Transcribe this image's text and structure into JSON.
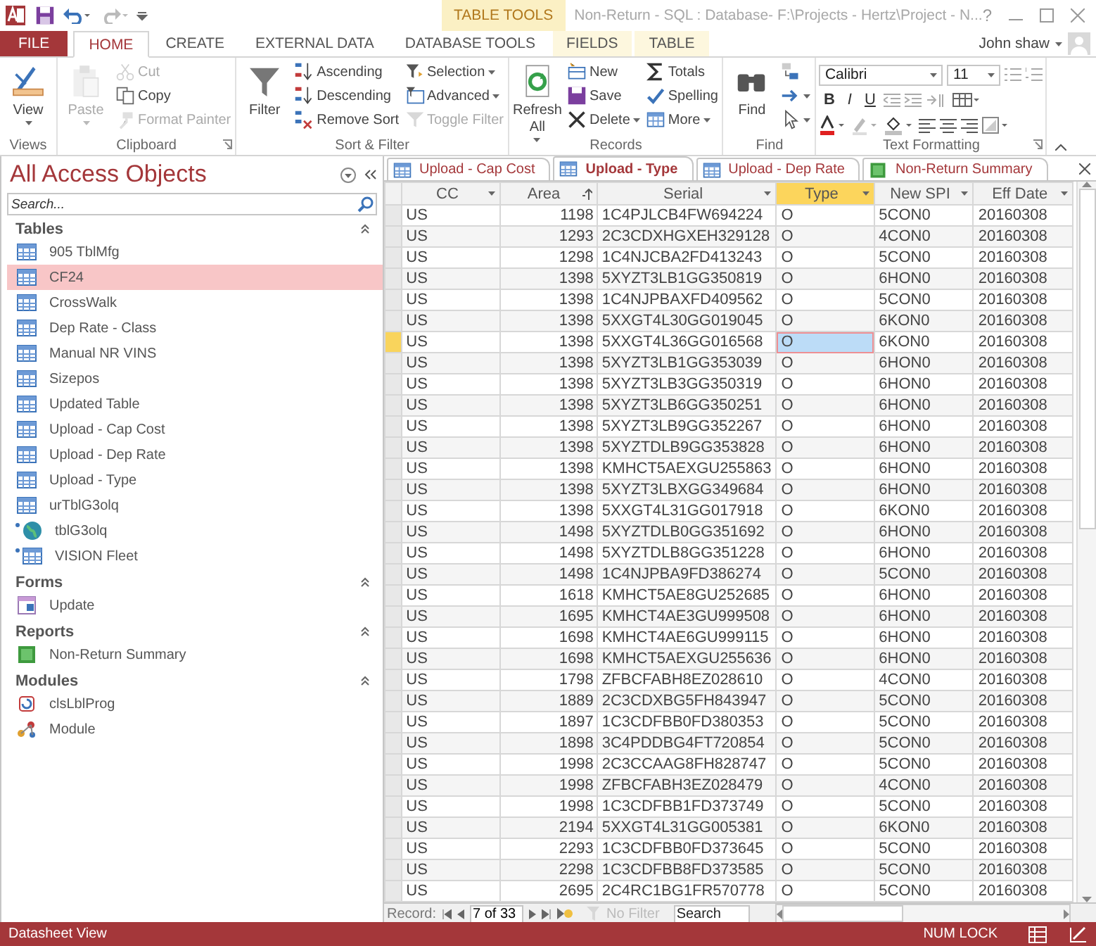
{
  "window": {
    "title": "Non-Return - SQL : Database- F:\\Projects - Hertz\\Project - N...",
    "context_group": "TABLE TOOLS",
    "help": "?",
    "user": "John shaw"
  },
  "ribbon_tabs": [
    {
      "label": "FILE",
      "kind": "file",
      "selected": false
    },
    {
      "label": "HOME",
      "kind": "main",
      "selected": true
    },
    {
      "label": "CREATE",
      "kind": "main",
      "selected": false
    },
    {
      "label": "EXTERNAL DATA",
      "kind": "main",
      "selected": false
    },
    {
      "label": "DATABASE TOOLS",
      "kind": "main",
      "selected": false
    },
    {
      "label": "FIELDS",
      "kind": "context",
      "selected": false
    },
    {
      "label": "TABLE",
      "kind": "context",
      "selected": false
    }
  ],
  "ribbon_groups": [
    {
      "label": "Views",
      "launcher": false,
      "commands": [
        {
          "label": "View",
          "kind": "large",
          "dropdown": true,
          "disabled": false
        }
      ]
    },
    {
      "label": "Clipboard",
      "launcher": true,
      "commands": [
        {
          "label": "Paste",
          "kind": "large",
          "dropdown": true,
          "disabled": true
        },
        {
          "label": "Cut",
          "kind": "small",
          "dropdown": false,
          "disabled": true
        },
        {
          "label": "Copy",
          "kind": "small",
          "dropdown": false,
          "disabled": false
        },
        {
          "label": "Format Painter",
          "kind": "small",
          "dropdown": false,
          "disabled": true
        }
      ]
    },
    {
      "label": "Sort & Filter",
      "launcher": false,
      "commands": [
        {
          "label": "Filter",
          "kind": "large",
          "dropdown": false,
          "disabled": false
        },
        {
          "label": "Ascending",
          "kind": "small",
          "dropdown": false,
          "disabled": false
        },
        {
          "label": "Descending",
          "kind": "small",
          "dropdown": false,
          "disabled": false
        },
        {
          "label": "Remove Sort",
          "kind": "small",
          "dropdown": false,
          "disabled": false
        },
        {
          "label": "Selection",
          "kind": "small",
          "dropdown": true,
          "disabled": false
        },
        {
          "label": "Advanced",
          "kind": "small",
          "dropdown": true,
          "disabled": false
        },
        {
          "label": "Toggle Filter",
          "kind": "small",
          "dropdown": false,
          "disabled": true
        }
      ]
    },
    {
      "label": "Records",
      "launcher": false,
      "commands": [
        {
          "label": "Refresh All",
          "kind": "large",
          "dropdown": true,
          "disabled": false
        },
        {
          "label": "New",
          "kind": "small",
          "dropdown": false,
          "disabled": false
        },
        {
          "label": "Save",
          "kind": "small",
          "dropdown": false,
          "disabled": false
        },
        {
          "label": "Delete",
          "kind": "small",
          "dropdown": true,
          "disabled": false
        },
        {
          "label": "Totals",
          "kind": "small",
          "dropdown": false,
          "disabled": false
        },
        {
          "label": "Spelling",
          "kind": "small",
          "dropdown": false,
          "disabled": false
        },
        {
          "label": "More",
          "kind": "small",
          "dropdown": true,
          "disabled": false
        }
      ]
    },
    {
      "label": "Find",
      "launcher": false,
      "commands": [
        {
          "label": "Find",
          "kind": "large",
          "dropdown": false,
          "disabled": false
        },
        {
          "kind": "icon",
          "dropdown": false,
          "disabled": false
        },
        {
          "kind": "icon",
          "dropdown": true,
          "disabled": false
        },
        {
          "kind": "icon",
          "dropdown": true,
          "disabled": false
        }
      ]
    },
    {
      "label": "Text Formatting",
      "launcher": true,
      "font": "Calibri",
      "size": "11",
      "format_buttons": [
        "B",
        "I",
        "U"
      ]
    }
  ],
  "navigation": {
    "title": "All Access Objects",
    "search_placeholder": "Search...",
    "groups": [
      {
        "label": "Tables",
        "expanded": true,
        "items": [
          {
            "label": "905 TblMfg",
            "kind": "table",
            "selected": false
          },
          {
            "label": "CF24",
            "kind": "table",
            "selected": true
          },
          {
            "label": "CrossWalk",
            "kind": "table",
            "selected": false
          },
          {
            "label": "Dep Rate - Class",
            "kind": "table",
            "selected": false
          },
          {
            "label": "Manual NR VINS",
            "kind": "table",
            "selected": false
          },
          {
            "label": "Sizepos",
            "kind": "table",
            "selected": false
          },
          {
            "label": "Updated Table",
            "kind": "table",
            "selected": false
          },
          {
            "label": "Upload - Cap Cost",
            "kind": "table",
            "selected": false
          },
          {
            "label": "Upload - Dep Rate",
            "kind": "table",
            "selected": false
          },
          {
            "label": "Upload - Type",
            "kind": "table",
            "selected": false
          },
          {
            "label": "urTblG3olq",
            "kind": "table",
            "selected": false
          },
          {
            "label": "tblG3olq",
            "kind": "linked_web",
            "selected": false
          },
          {
            "label": "VISION Fleet",
            "kind": "linked_table",
            "selected": false
          }
        ]
      },
      {
        "label": "Forms",
        "expanded": true,
        "items": [
          {
            "label": "Update",
            "kind": "form",
            "selected": false
          }
        ]
      },
      {
        "label": "Reports",
        "expanded": true,
        "items": [
          {
            "label": "Non-Return Summary",
            "kind": "report",
            "selected": false
          }
        ]
      },
      {
        "label": "Modules",
        "expanded": true,
        "items": [
          {
            "label": "clsLblProg",
            "kind": "class_module",
            "selected": false
          },
          {
            "label": "Module",
            "kind": "module",
            "selected": false
          }
        ]
      }
    ]
  },
  "document_tabs": [
    {
      "label": "Upload - Cap Cost",
      "kind": "table",
      "selected": false
    },
    {
      "label": "Upload - Type",
      "kind": "table",
      "selected": true
    },
    {
      "label": "Upload - Dep Rate",
      "kind": "table",
      "selected": false
    },
    {
      "label": "Non-Return Summary",
      "kind": "report",
      "selected": false
    }
  ],
  "datasheet": {
    "columns": [
      {
        "label": "CC",
        "kind": "text",
        "sorted": false,
        "selected": false
      },
      {
        "label": "Area",
        "kind": "number",
        "sorted": true,
        "selected": false
      },
      {
        "label": "Serial",
        "kind": "text",
        "sorted": false,
        "selected": false
      },
      {
        "label": "Type",
        "kind": "text",
        "sorted": false,
        "selected": true
      },
      {
        "label": "New SPI",
        "kind": "text",
        "sorted": false,
        "selected": false
      },
      {
        "label": "Eff Date",
        "kind": "text",
        "sorted": false,
        "selected": false
      }
    ],
    "rows": [
      {
        "selected": false,
        "cells": [
          "US",
          "1198",
          "1C4PJLCB4FW694224",
          "O",
          "5CON0",
          "20160308"
        ]
      },
      {
        "selected": false,
        "cells": [
          "US",
          "1293",
          "2C3CDXHGXEH329128",
          "O",
          "4CON0",
          "20160308"
        ]
      },
      {
        "selected": false,
        "cells": [
          "US",
          "1298",
          "1C4NJCBA2FD413243",
          "O",
          "5CON0",
          "20160308"
        ]
      },
      {
        "selected": false,
        "cells": [
          "US",
          "1398",
          "5XYZT3LB1GG350819",
          "O",
          "6HON0",
          "20160308"
        ]
      },
      {
        "selected": false,
        "cells": [
          "US",
          "1398",
          "1C4NJPBAXFD409562",
          "O",
          "5CON0",
          "20160308"
        ]
      },
      {
        "selected": false,
        "cells": [
          "US",
          "1398",
          "5XXGT4L30GG019045",
          "O",
          "6KON0",
          "20160308"
        ]
      },
      {
        "selected": true,
        "cells": [
          "US",
          "1398",
          "5XXGT4L36GG016568",
          "O",
          "6KON0",
          "20160308"
        ]
      },
      {
        "selected": false,
        "cells": [
          "US",
          "1398",
          "5XYZT3LB1GG353039",
          "O",
          "6HON0",
          "20160308"
        ]
      },
      {
        "selected": false,
        "cells": [
          "US",
          "1398",
          "5XYZT3LB3GG350319",
          "O",
          "6HON0",
          "20160308"
        ]
      },
      {
        "selected": false,
        "cells": [
          "US",
          "1398",
          "5XYZT3LB6GG350251",
          "O",
          "6HON0",
          "20160308"
        ]
      },
      {
        "selected": false,
        "cells": [
          "US",
          "1398",
          "5XYZT3LB9GG352267",
          "O",
          "6HON0",
          "20160308"
        ]
      },
      {
        "selected": false,
        "cells": [
          "US",
          "1398",
          "5XYZTDLB9GG353828",
          "O",
          "6HON0",
          "20160308"
        ]
      },
      {
        "selected": false,
        "cells": [
          "US",
          "1398",
          "KMHCT5AEXGU255863",
          "O",
          "6HON0",
          "20160308"
        ]
      },
      {
        "selected": false,
        "cells": [
          "US",
          "1398",
          "5XYZT3LBXGG349684",
          "O",
          "6HON0",
          "20160308"
        ]
      },
      {
        "selected": false,
        "cells": [
          "US",
          "1398",
          "5XXGT4L31GG017918",
          "O",
          "6KON0",
          "20160308"
        ]
      },
      {
        "selected": false,
        "cells": [
          "US",
          "1498",
          "5XYZTDLB0GG351692",
          "O",
          "6HON0",
          "20160308"
        ]
      },
      {
        "selected": false,
        "cells": [
          "US",
          "1498",
          "5XYZTDLB8GG351228",
          "O",
          "6HON0",
          "20160308"
        ]
      },
      {
        "selected": false,
        "cells": [
          "US",
          "1498",
          "1C4NJPBA9FD386274",
          "O",
          "5CON0",
          "20160308"
        ]
      },
      {
        "selected": false,
        "cells": [
          "US",
          "1618",
          "KMHCT5AE8GU252685",
          "O",
          "6HON0",
          "20160308"
        ]
      },
      {
        "selected": false,
        "cells": [
          "US",
          "1695",
          "KMHCT4AE3GU999508",
          "O",
          "6HON0",
          "20160308"
        ]
      },
      {
        "selected": false,
        "cells": [
          "US",
          "1698",
          "KMHCT4AE6GU999115",
          "O",
          "6HON0",
          "20160308"
        ]
      },
      {
        "selected": false,
        "cells": [
          "US",
          "1698",
          "KMHCT5AEXGU255636",
          "O",
          "6HON0",
          "20160308"
        ]
      },
      {
        "selected": false,
        "cells": [
          "US",
          "1798",
          "ZFBCFABH8EZ028610",
          "O",
          "4CON0",
          "20160308"
        ]
      },
      {
        "selected": false,
        "cells": [
          "US",
          "1889",
          "2C3CDXBG5FH843947",
          "O",
          "5CON0",
          "20160308"
        ]
      },
      {
        "selected": false,
        "cells": [
          "US",
          "1897",
          "1C3CDFBB0FD380353",
          "O",
          "5CON0",
          "20160308"
        ]
      },
      {
        "selected": false,
        "cells": [
          "US",
          "1898",
          "3C4PDDBG4FT720854",
          "O",
          "5CON0",
          "20160308"
        ]
      },
      {
        "selected": false,
        "cells": [
          "US",
          "1998",
          "2C3CCAAG8FH828747",
          "O",
          "5CON0",
          "20160308"
        ]
      },
      {
        "selected": false,
        "cells": [
          "US",
          "1998",
          "ZFBCFABH3EZ028479",
          "O",
          "4CON0",
          "20160308"
        ]
      },
      {
        "selected": false,
        "cells": [
          "US",
          "1998",
          "1C3CDFBB1FD373749",
          "O",
          "5CON0",
          "20160308"
        ]
      },
      {
        "selected": false,
        "cells": [
          "US",
          "2194",
          "5XXGT4L31GG005381",
          "O",
          "6KON0",
          "20160308"
        ]
      },
      {
        "selected": false,
        "cells": [
          "US",
          "2293",
          "1C3CDFBB0FD373645",
          "O",
          "5CON0",
          "20160308"
        ]
      },
      {
        "selected": false,
        "cells": [
          "US",
          "2298",
          "1C3CDFBB8FD373585",
          "O",
          "5CON0",
          "20160308"
        ]
      },
      {
        "selected": false,
        "cells": [
          "US",
          "2695",
          "2C4RC1BG1FR570778",
          "O",
          "5CON0",
          "20160308"
        ]
      }
    ]
  },
  "record_navigation": {
    "label": "Record:",
    "position": "7 of 33",
    "filter": "No Filter",
    "filter_disabled": true,
    "search_placeholder": "Search"
  },
  "status_bar": {
    "view": "Datasheet View",
    "indicator": "NUM LOCK"
  }
}
